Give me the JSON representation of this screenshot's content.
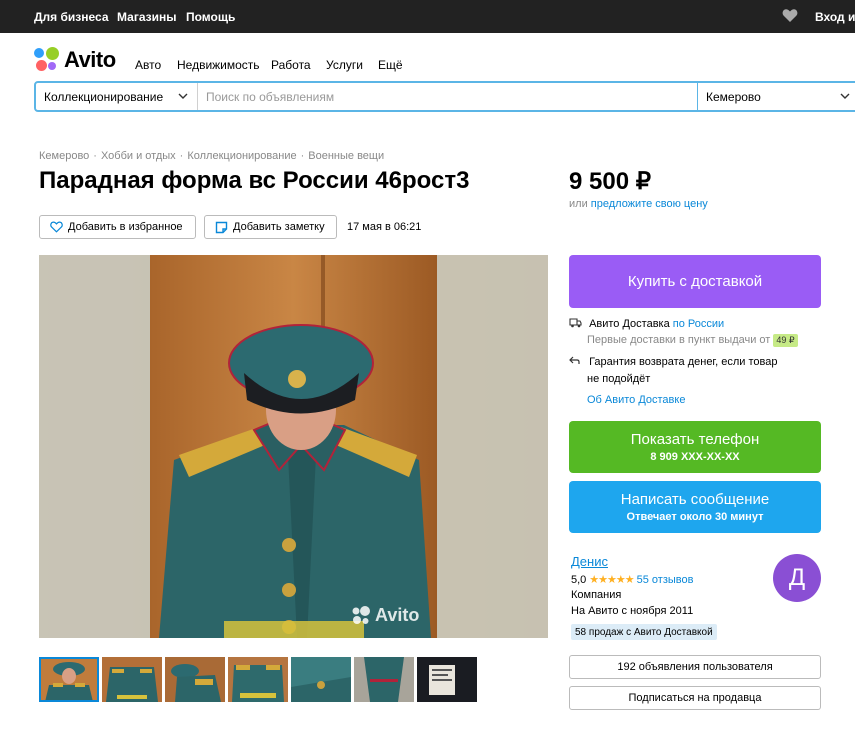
{
  "topbar": {
    "business": "Для бизнеса",
    "shops": "Магазины",
    "help": "Помощь",
    "login": "Вход и р"
  },
  "header": {
    "logo_text": "Avito",
    "nav": [
      "Авто",
      "Недвижимость",
      "Работа",
      "Услуги",
      "Ещё"
    ]
  },
  "search": {
    "category": "Коллекционирование",
    "placeholder": "Поиск по объявлениям",
    "city": "Кемерово"
  },
  "item": {
    "breadcrumb": [
      "Кемерово",
      "Хобби и отдых",
      "Коллекционирование",
      "Военные вещи"
    ],
    "title": "Парадная форма вс России 46рост3",
    "price": "9 500 ₽",
    "price_offer_prefix": "или",
    "price_offer_link": "предложите свою цену",
    "favorite_label": "Добавить в избранное",
    "note_label": "Добавить заметку",
    "date": "17 мая в 06:21",
    "watermark": "Avito",
    "thumbnail_count": 7
  },
  "actions": {
    "buy_label": "Купить с доставкой",
    "phone_label": "Показать телефон",
    "phone_number": "8 909 XXX-XX-XX",
    "message_label": "Написать сообщение",
    "message_sub": "Отвечает около 30 минут"
  },
  "delivery": {
    "title": "Авито Доставка",
    "region_link": "по России",
    "first_delivery": "Первые доставки в пункт выдачи от",
    "price_badge": "49 ₽",
    "guarantee_line1": "Гарантия возврата денег, если товар",
    "guarantee_line2": "не подойдёт",
    "about_link": "Об Авито Доставке"
  },
  "seller": {
    "name": "Денис",
    "rating": "5,0",
    "stars": "★★★★★",
    "reviews": "55 отзывов",
    "type": "Компания",
    "since": "На Авито с ноября 2011",
    "sales_badge": "58 продаж с Авито Доставкой",
    "avatar_letter": "Д",
    "ads_button": "192 объявления пользователя",
    "subscribe_button": "Подписаться на продавца"
  },
  "colors": {
    "buy": "#9a5cf5",
    "phone": "#55b924",
    "message": "#1ea6ee",
    "link": "#0a88d8",
    "avatar": "#8a4fd4",
    "topbar": "#222222"
  }
}
